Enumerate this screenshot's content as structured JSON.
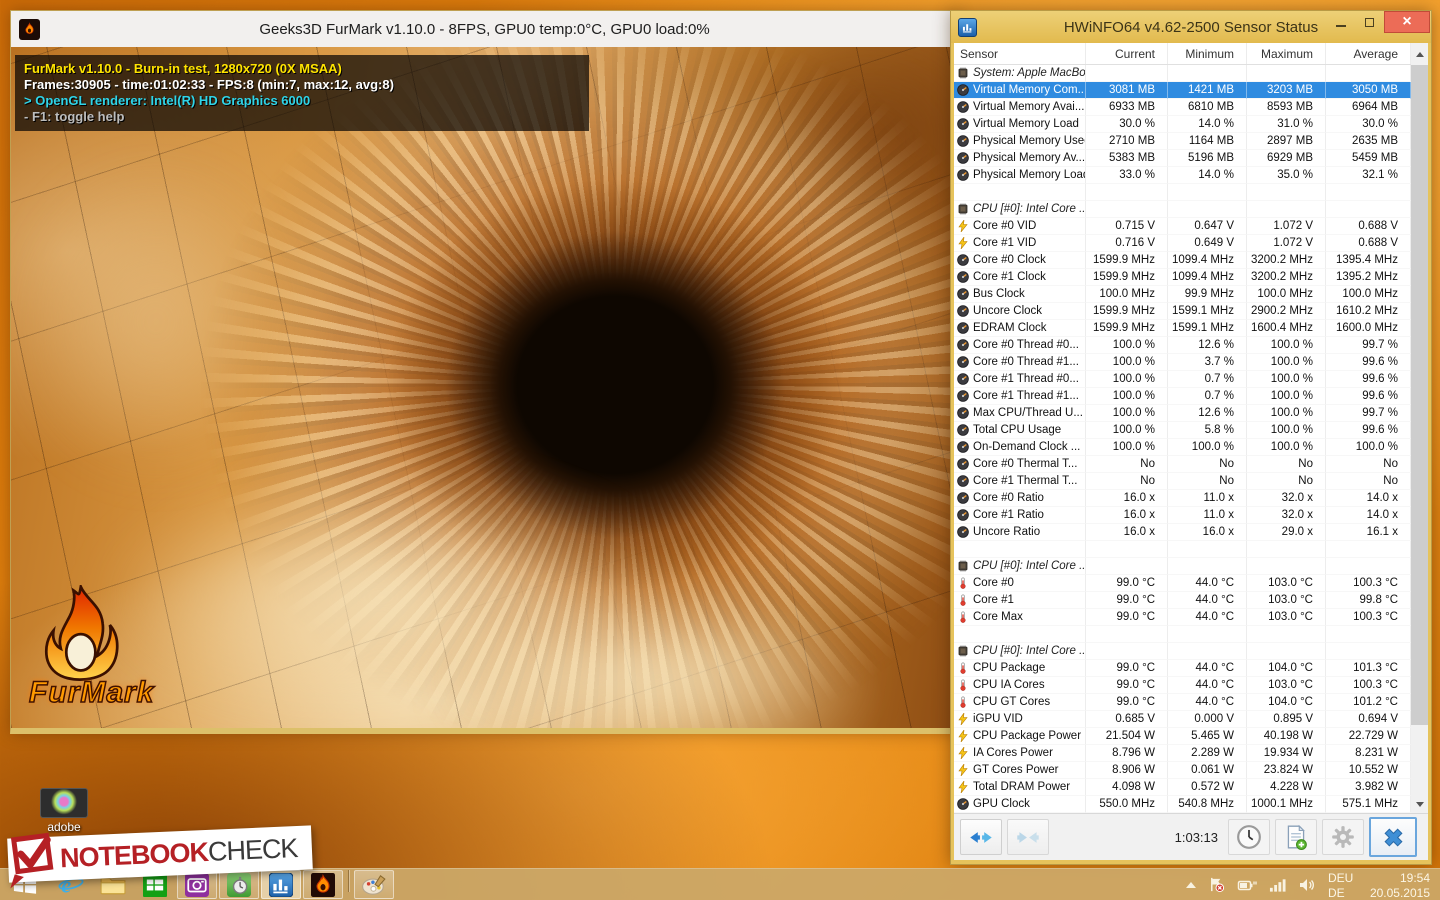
{
  "furmark": {
    "title": "Geeks3D FurMark v1.10.0 - 8FPS, GPU0 temp:0°C, GPU0 load:0%",
    "overlay": {
      "line1": "FurMark v1.10.0 - Burn-in test, 1280x720 (0X MSAA)",
      "line2": "Frames:30905 - time:01:02:33 - FPS:8 (min:7, max:12, avg:8)",
      "line3": "> OpenGL renderer: Intel(R) HD Graphics 6000",
      "line4": "- F1: toggle help"
    },
    "logo_text": "FurMark"
  },
  "hwinfo": {
    "title": "HWiNFO64 v4.62-2500 Sensor Status",
    "columns": [
      "Sensor",
      "Current",
      "Minimum",
      "Maximum",
      "Average"
    ],
    "statusbar": {
      "timer": "1:03:13"
    },
    "sections": [
      {
        "header": "System: Apple MacBo...",
        "rows": [
          {
            "icon": "gauge",
            "label": "Virtual Memory Com...",
            "values": [
              "3081 MB",
              "1421 MB",
              "3203 MB",
              "3050 MB"
            ],
            "selected": true
          },
          {
            "icon": "gauge",
            "label": "Virtual Memory Avai...",
            "values": [
              "6933 MB",
              "6810 MB",
              "8593 MB",
              "6964 MB"
            ]
          },
          {
            "icon": "gauge",
            "label": "Virtual Memory Load",
            "values": [
              "30.0 %",
              "14.0 %",
              "31.0 %",
              "30.0 %"
            ]
          },
          {
            "icon": "gauge",
            "label": "Physical Memory Used",
            "values": [
              "2710 MB",
              "1164 MB",
              "2897 MB",
              "2635 MB"
            ]
          },
          {
            "icon": "gauge",
            "label": "Physical Memory Av...",
            "values": [
              "5383 MB",
              "5196 MB",
              "6929 MB",
              "5459 MB"
            ]
          },
          {
            "icon": "gauge",
            "label": "Physical Memory Load",
            "values": [
              "33.0 %",
              "14.0 %",
              "35.0 %",
              "32.1 %"
            ]
          }
        ]
      },
      {
        "header": "CPU [#0]: Intel Core ...",
        "rows": [
          {
            "icon": "lightning",
            "label": "Core #0 VID",
            "values": [
              "0.715 V",
              "0.647 V",
              "1.072 V",
              "0.688 V"
            ]
          },
          {
            "icon": "lightning",
            "label": "Core #1 VID",
            "values": [
              "0.716 V",
              "0.649 V",
              "1.072 V",
              "0.688 V"
            ]
          },
          {
            "icon": "gauge",
            "label": "Core #0 Clock",
            "values": [
              "1599.9 MHz",
              "1099.4 MHz",
              "3200.2 MHz",
              "1395.4 MHz"
            ]
          },
          {
            "icon": "gauge",
            "label": "Core #1 Clock",
            "values": [
              "1599.9 MHz",
              "1099.4 MHz",
              "3200.2 MHz",
              "1395.2 MHz"
            ]
          },
          {
            "icon": "gauge",
            "label": "Bus Clock",
            "values": [
              "100.0 MHz",
              "99.9 MHz",
              "100.0 MHz",
              "100.0 MHz"
            ]
          },
          {
            "icon": "gauge",
            "label": "Uncore Clock",
            "values": [
              "1599.9 MHz",
              "1599.1 MHz",
              "2900.2 MHz",
              "1610.2 MHz"
            ]
          },
          {
            "icon": "gauge",
            "label": "EDRAM Clock",
            "values": [
              "1599.9 MHz",
              "1599.1 MHz",
              "1600.4 MHz",
              "1600.0 MHz"
            ]
          },
          {
            "icon": "gauge",
            "label": "Core #0 Thread #0...",
            "values": [
              "100.0 %",
              "12.6 %",
              "100.0 %",
              "99.7 %"
            ]
          },
          {
            "icon": "gauge",
            "label": "Core #0 Thread #1...",
            "values": [
              "100.0 %",
              "3.7 %",
              "100.0 %",
              "99.6 %"
            ]
          },
          {
            "icon": "gauge",
            "label": "Core #1 Thread #0...",
            "values": [
              "100.0 %",
              "0.7 %",
              "100.0 %",
              "99.6 %"
            ]
          },
          {
            "icon": "gauge",
            "label": "Core #1 Thread #1...",
            "values": [
              "100.0 %",
              "0.7 %",
              "100.0 %",
              "99.6 %"
            ]
          },
          {
            "icon": "gauge",
            "label": "Max CPU/Thread U...",
            "values": [
              "100.0 %",
              "12.6 %",
              "100.0 %",
              "99.7 %"
            ]
          },
          {
            "icon": "gauge",
            "label": "Total CPU Usage",
            "values": [
              "100.0 %",
              "5.8 %",
              "100.0 %",
              "99.6 %"
            ]
          },
          {
            "icon": "gauge",
            "label": "On-Demand Clock ...",
            "values": [
              "100.0 %",
              "100.0 %",
              "100.0 %",
              "100.0 %"
            ]
          },
          {
            "icon": "gauge",
            "label": "Core #0 Thermal T...",
            "values": [
              "No",
              "No",
              "No",
              "No"
            ]
          },
          {
            "icon": "gauge",
            "label": "Core #1 Thermal T...",
            "values": [
              "No",
              "No",
              "No",
              "No"
            ]
          },
          {
            "icon": "gauge",
            "label": "Core #0 Ratio",
            "values": [
              "16.0 x",
              "11.0 x",
              "32.0 x",
              "14.0 x"
            ]
          },
          {
            "icon": "gauge",
            "label": "Core #1 Ratio",
            "values": [
              "16.0 x",
              "11.0 x",
              "32.0 x",
              "14.0 x"
            ]
          },
          {
            "icon": "gauge",
            "label": "Uncore Ratio",
            "values": [
              "16.0 x",
              "16.0 x",
              "29.0 x",
              "16.1 x"
            ]
          }
        ]
      },
      {
        "header": "CPU [#0]: Intel Core ...",
        "rows": [
          {
            "icon": "thermo",
            "label": "Core #0",
            "values": [
              "99.0 °C",
              "44.0 °C",
              "103.0 °C",
              "100.3 °C"
            ]
          },
          {
            "icon": "thermo",
            "label": "Core #1",
            "values": [
              "99.0 °C",
              "44.0 °C",
              "103.0 °C",
              "99.8 °C"
            ]
          },
          {
            "icon": "thermo",
            "label": "Core Max",
            "values": [
              "99.0 °C",
              "44.0 °C",
              "103.0 °C",
              "100.3 °C"
            ]
          }
        ]
      },
      {
        "header": "CPU [#0]: Intel Core ...",
        "rows": [
          {
            "icon": "thermo",
            "label": "CPU Package",
            "values": [
              "99.0 °C",
              "44.0 °C",
              "104.0 °C",
              "101.3 °C"
            ]
          },
          {
            "icon": "thermo",
            "label": "CPU IA Cores",
            "values": [
              "99.0 °C",
              "44.0 °C",
              "103.0 °C",
              "100.3 °C"
            ]
          },
          {
            "icon": "thermo",
            "label": "CPU GT Cores",
            "values": [
              "99.0 °C",
              "44.0 °C",
              "104.0 °C",
              "101.2 °C"
            ]
          },
          {
            "icon": "lightning",
            "label": "iGPU VID",
            "values": [
              "0.685 V",
              "0.000 V",
              "0.895 V",
              "0.694 V"
            ]
          },
          {
            "icon": "lightning",
            "label": "CPU Package Power",
            "values": [
              "21.504 W",
              "5.465 W",
              "40.198 W",
              "22.729 W"
            ]
          },
          {
            "icon": "lightning",
            "label": "IA Cores Power",
            "values": [
              "8.796 W",
              "2.289 W",
              "19.934 W",
              "8.231 W"
            ]
          },
          {
            "icon": "lightning",
            "label": "GT Cores Power",
            "values": [
              "8.906 W",
              "0.061 W",
              "23.824 W",
              "10.552 W"
            ]
          },
          {
            "icon": "lightning",
            "label": "Total DRAM Power",
            "values": [
              "4.098 W",
              "0.572 W",
              "4.228 W",
              "3.982 W"
            ]
          },
          {
            "icon": "gauge",
            "label": "GPU Clock",
            "values": [
              "550.0 MHz",
              "540.8 MHz",
              "1000.1 MHz",
              "575.1 MHz"
            ]
          }
        ]
      }
    ]
  },
  "desktop": {
    "adobe_label": "adobe",
    "watermark_part1": "NOTEBOOK",
    "watermark_part2": "CHECK"
  },
  "taskbar": {
    "items": [
      {
        "name": "internet-explorer",
        "running": false
      },
      {
        "name": "file-explorer",
        "running": false
      },
      {
        "name": "windows-store",
        "running": false
      },
      {
        "name": "screenshot-tool",
        "running": true
      },
      {
        "name": "stopwatch-benchmark",
        "running": true
      },
      {
        "name": "hwinfo",
        "running": true,
        "active": true
      },
      {
        "name": "furmark",
        "running": true
      },
      {
        "name": "paint",
        "running": true,
        "divider_before": true
      }
    ],
    "tray": {
      "lang": "DEU",
      "time": "19:54",
      "lang2": "DE",
      "date": "20.05.2015"
    }
  }
}
